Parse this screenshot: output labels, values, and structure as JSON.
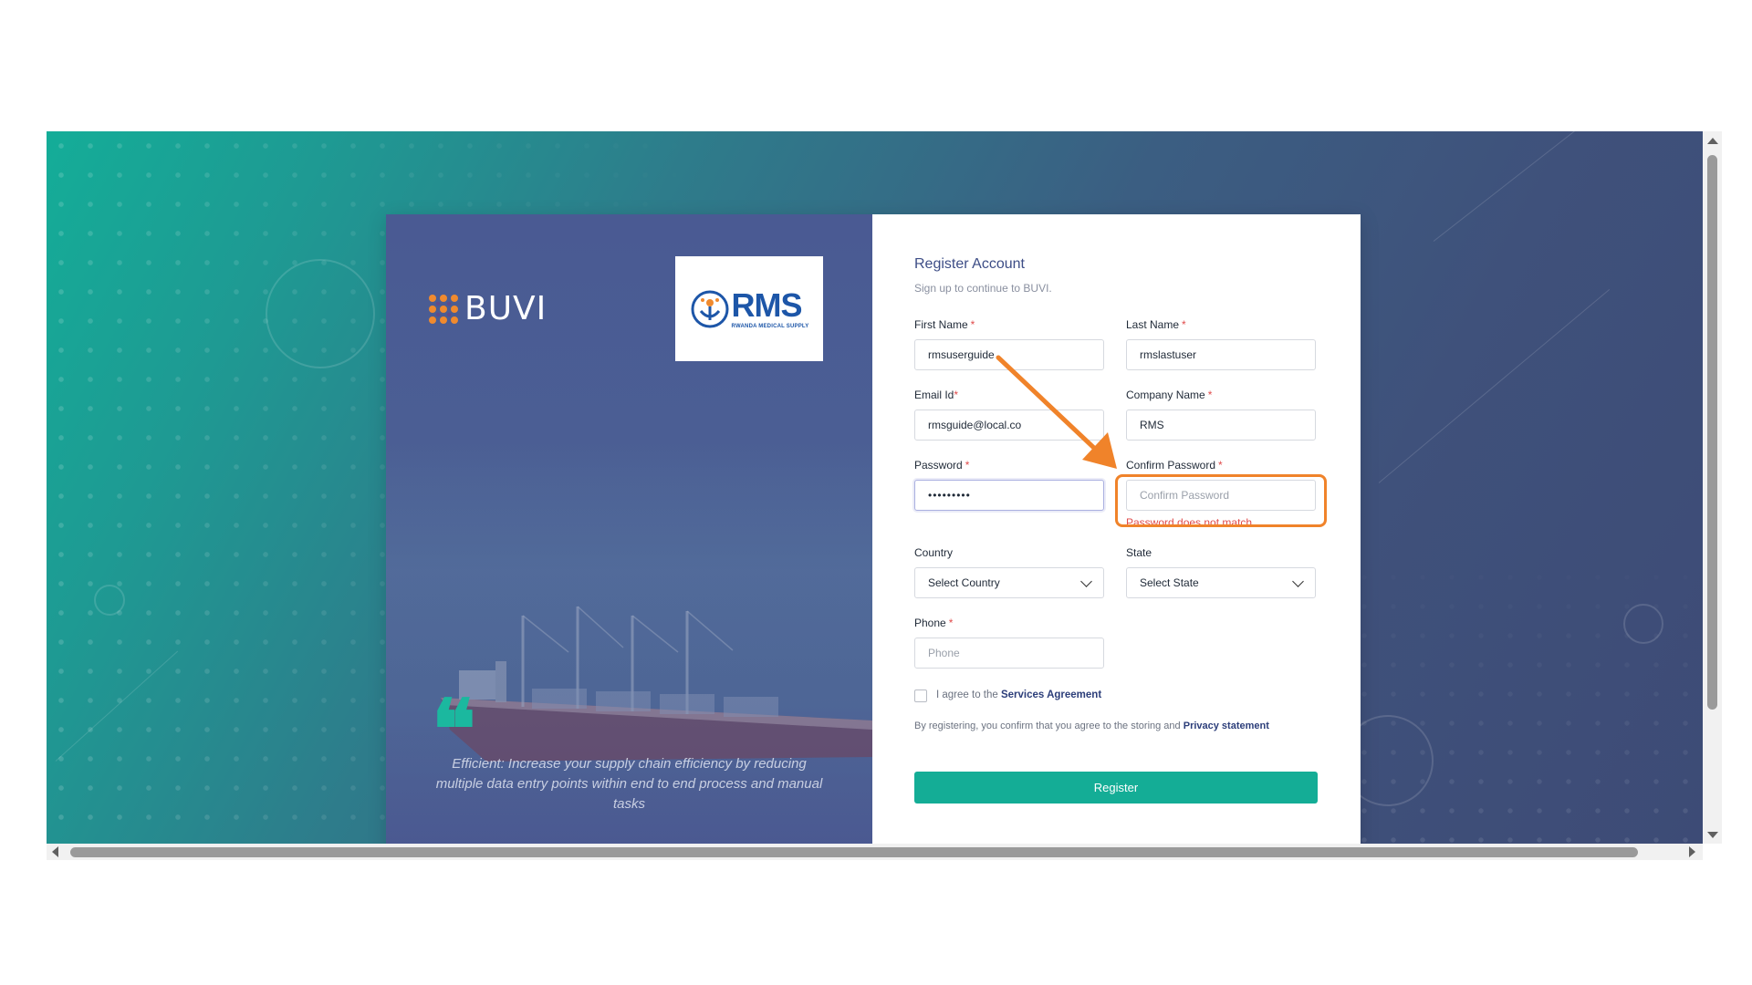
{
  "left_panel": {
    "brand": "BUVI",
    "partner": {
      "letters": "RMS",
      "subtitle": "RWANDA MEDICAL SUPPLY"
    },
    "quote_mark": "❝",
    "quote": "Efficient: Increase your supply chain efficiency by reducing multiple data entry points within end to end process and manual tasks"
  },
  "form": {
    "title": "Register Account",
    "subtitle": "Sign up to continue to BUVI.",
    "required_mark": "*",
    "first_name": {
      "label": "First Name",
      "value": "rmsuserguide"
    },
    "last_name": {
      "label": "Last Name",
      "value": "rmslastuser"
    },
    "email": {
      "label": "Email Id",
      "value": "rmsguide@local.co"
    },
    "company": {
      "label": "Company Name",
      "value": "RMS"
    },
    "password": {
      "label": "Password",
      "value": "•••••••••"
    },
    "confirm_password": {
      "label": "Confirm Password",
      "placeholder": "Confirm Password",
      "error": "Password does not match"
    },
    "country": {
      "label": "Country",
      "value": "Select Country"
    },
    "state": {
      "label": "State",
      "value": "Select State"
    },
    "phone": {
      "label": "Phone",
      "placeholder": "Phone"
    },
    "agree": {
      "text": "I agree to the",
      "link": "Services Agreement"
    },
    "privacy": {
      "text": "By registering, you confirm that you agree to the storing and",
      "link": "Privacy statement"
    },
    "submit_label": "Register"
  },
  "colors": {
    "accent": "#14ad96",
    "annotation": "#f0832a",
    "error": "#e04b4b",
    "title": "#3d4d86"
  },
  "icons": [
    "buvi-logo-icon",
    "rms-logo-icon",
    "chevron-down-icon",
    "quote-icon",
    "arrow-annotation-icon"
  ]
}
